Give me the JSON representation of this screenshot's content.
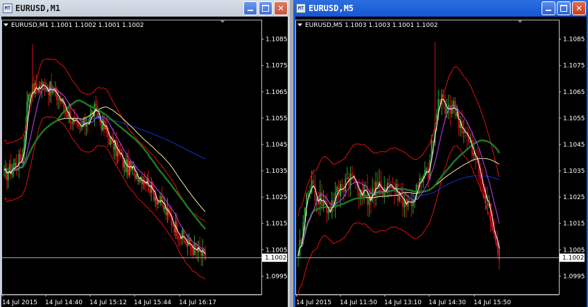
{
  "windows": [
    {
      "title": "EURUSD,M1",
      "header": "EURUSD,M1  1.1001 1.1002 1.1001 1.1002",
      "price_scale": [
        "1.1085",
        "1.1075",
        "1.1065",
        "1.1055",
        "1.1045",
        "1.1035",
        "1.1025",
        "1.1015",
        "1.1005",
        "1.0995"
      ],
      "current_price": "1.1002",
      "time_labels": [
        "14 Jul 2015",
        "14 Jul 14:40",
        "14 Jul 15:12",
        "14 Jul 15:44",
        "14 Jul 16:17"
      ]
    },
    {
      "title": "EURUSD,M5",
      "header": "EURUSD,M5  1.1003 1.1003 1.1001 1.1002",
      "price_scale": [
        "1.1085",
        "1.1075",
        "1.1065",
        "1.1055",
        "1.1045",
        "1.1035",
        "1.1025",
        "1.1015",
        "1.1005",
        "1.0995"
      ],
      "current_price": "1.1002",
      "time_labels": [
        "14 Jul 2015",
        "14 Jul 11:50",
        "14 Jul 13:10",
        "14 Jul 14:30",
        "14 Jul 15:50"
      ]
    }
  ],
  "controls": {
    "minimize": "minimize",
    "maximize": "maximize",
    "close": "close"
  },
  "colors": {
    "up": "#2e9e2e",
    "down": "#d01010",
    "band": "#e01010",
    "ma_fast": "#ffffff",
    "ma_mid": "#c040ff",
    "ma_green": "#1e7a1e",
    "ma_yellow": "#f4f0a0",
    "ma_blue": "#1430d8"
  }
}
